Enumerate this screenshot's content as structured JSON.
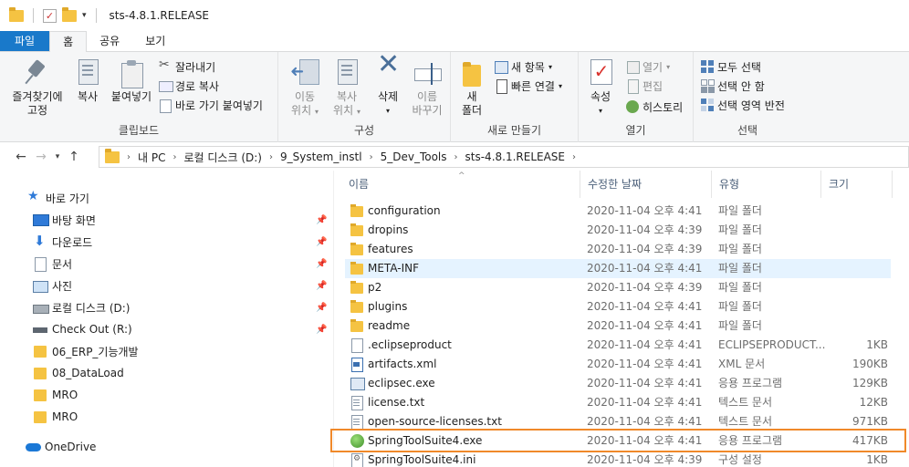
{
  "window": {
    "title": "sts-4.8.1.RELEASE"
  },
  "tabs": [
    {
      "label": "파일"
    },
    {
      "label": "홈"
    },
    {
      "label": "공유"
    },
    {
      "label": "보기"
    }
  ],
  "ribbon": {
    "clipboard": {
      "label": "클립보드",
      "pin_line1": "즐겨찾기에",
      "pin_line2": "고정",
      "copy": "복사",
      "paste": "붙여넣기",
      "cut": "잘라내기",
      "copy_path": "경로 복사",
      "paste_shortcut": "바로 가기 붙여넣기"
    },
    "organize": {
      "label": "구성",
      "move_line1": "이동",
      "move_line2": "위치",
      "copyto_line1": "복사",
      "copyto_line2": "위치",
      "delete": "삭제",
      "rename_line1": "이름",
      "rename_line2": "바꾸기"
    },
    "new": {
      "label": "새로 만들기",
      "folder_line1": "새",
      "folder_line2": "폴더",
      "new_item": "새 항목",
      "easy_access": "빠른 연결"
    },
    "open": {
      "label": "열기",
      "properties": "속성",
      "open": "열기",
      "edit": "편집",
      "history": "히스토리"
    },
    "select": {
      "label": "선택",
      "select_all": "모두 선택",
      "select_none": "선택 안 함",
      "invert": "선택 영역 반전"
    }
  },
  "address": {
    "crumbs": [
      "내 PC",
      "로컬 디스크 (D:)",
      "9_System_instl",
      "5_Dev_Tools",
      "sts-4.8.1.RELEASE"
    ]
  },
  "nav": {
    "quick_access": "바로 가기",
    "items": [
      {
        "label": "바탕 화면"
      },
      {
        "label": "다운로드"
      },
      {
        "label": "문서"
      },
      {
        "label": "사진"
      },
      {
        "label": "로컬 디스크 (D:)"
      },
      {
        "label": "Check Out  (R:)"
      },
      {
        "label": "06_ERP_기능개발"
      },
      {
        "label": "08_DataLoad"
      },
      {
        "label": "MRO"
      },
      {
        "label": "MRO"
      }
    ],
    "onedrive": "OneDrive"
  },
  "columns": {
    "name": "이름",
    "date": "수정한 날짜",
    "type": "유형",
    "size": "크기"
  },
  "files": [
    {
      "name": "configuration",
      "date": "2020-11-04 오후 4:41",
      "type": "파일 폴더",
      "size": ""
    },
    {
      "name": "dropins",
      "date": "2020-11-04 오후 4:39",
      "type": "파일 폴더",
      "size": ""
    },
    {
      "name": "features",
      "date": "2020-11-04 오후 4:39",
      "type": "파일 폴더",
      "size": ""
    },
    {
      "name": "META-INF",
      "date": "2020-11-04 오후 4:41",
      "type": "파일 폴더",
      "size": ""
    },
    {
      "name": "p2",
      "date": "2020-11-04 오후 4:39",
      "type": "파일 폴더",
      "size": ""
    },
    {
      "name": "plugins",
      "date": "2020-11-04 오후 4:41",
      "type": "파일 폴더",
      "size": ""
    },
    {
      "name": "readme",
      "date": "2020-11-04 오후 4:41",
      "type": "파일 폴더",
      "size": ""
    },
    {
      "name": ".eclipseproduct",
      "date": "2020-11-04 오후 4:41",
      "type": "ECLIPSEPRODUCT...",
      "size": "1KB"
    },
    {
      "name": "artifacts.xml",
      "date": "2020-11-04 오후 4:41",
      "type": "XML 문서",
      "size": "190KB"
    },
    {
      "name": "eclipsec.exe",
      "date": "2020-11-04 오후 4:41",
      "type": "응용 프로그램",
      "size": "129KB"
    },
    {
      "name": "license.txt",
      "date": "2020-11-04 오후 4:41",
      "type": "텍스트 문서",
      "size": "12KB"
    },
    {
      "name": "open-source-licenses.txt",
      "date": "2020-11-04 오후 4:41",
      "type": "텍스트 문서",
      "size": "971KB"
    },
    {
      "name": "SpringToolSuite4.exe",
      "date": "2020-11-04 오후 4:41",
      "type": "응용 프로그램",
      "size": "417KB"
    },
    {
      "name": "SpringToolSuite4.ini",
      "date": "2020-11-04 오후 4:39",
      "type": "구성 설정",
      "size": "1KB"
    }
  ]
}
